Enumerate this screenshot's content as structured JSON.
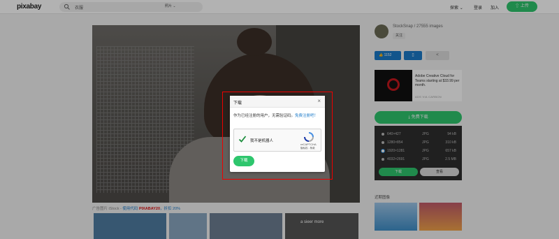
{
  "header": {
    "logo": "pixabay",
    "search_value": "衣服",
    "search_type": "照片",
    "nav": [
      "探索",
      "登录",
      "加入"
    ],
    "upload_label": "上传"
  },
  "caption": {
    "prefix": "广告图片 iStock - ",
    "promo": "使用代码 ",
    "code": "PIXABAY20",
    "suffix": "，折扣 20%"
  },
  "thumb_overlay_text": "a sieer more",
  "sidebar": {
    "author": "StockSnap / 27555 images",
    "follow_label": "关注",
    "like_count": "1152",
    "ad_text": "Adobe Creative Cloud for Teams starting at $33.99 per month.",
    "ad_carbon": "ADS VIA CARBON",
    "free_download_label": "免费下载",
    "download_options": [
      {
        "resolution": "640×427",
        "format": "JPG",
        "size": "94 kB"
      },
      {
        "resolution": "1280×854",
        "format": "JPG",
        "size": "310 kB"
      },
      {
        "resolution": "1920×1281",
        "format": "JPG",
        "size": "657 kB"
      },
      {
        "resolution": "4032×2691",
        "format": "JPG",
        "size": "2.5 MB"
      }
    ],
    "selected_option": 2,
    "panel_download_label": "下载",
    "panel_view_label": "查看",
    "related_title": "近期图像"
  },
  "modal": {
    "title": "下载",
    "message": "作为已经注册的用户，无需验证码。",
    "register_link": "免费注册吧！",
    "captcha_label": "我不是机器人",
    "captcha_brand": "reCAPTCHA",
    "captcha_terms": "隐私权 - 条款",
    "download_label": "下载"
  },
  "colors": {
    "accent_green": "#2ec66d",
    "link_blue": "#1a7ac9",
    "highlight_red": "#e00000"
  }
}
